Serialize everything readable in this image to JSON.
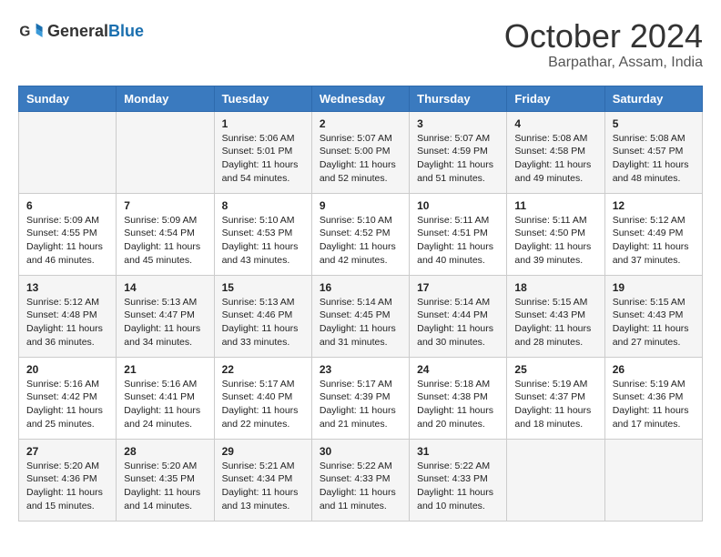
{
  "header": {
    "logo_general": "General",
    "logo_blue": "Blue",
    "month_title": "October 2024",
    "location": "Barpathar, Assam, India"
  },
  "weekdays": [
    "Sunday",
    "Monday",
    "Tuesday",
    "Wednesday",
    "Thursday",
    "Friday",
    "Saturday"
  ],
  "weeks": [
    [
      {
        "day": "",
        "content": ""
      },
      {
        "day": "",
        "content": ""
      },
      {
        "day": "1",
        "content": "Sunrise: 5:06 AM\nSunset: 5:01 PM\nDaylight: 11 hours and 54 minutes."
      },
      {
        "day": "2",
        "content": "Sunrise: 5:07 AM\nSunset: 5:00 PM\nDaylight: 11 hours and 52 minutes."
      },
      {
        "day": "3",
        "content": "Sunrise: 5:07 AM\nSunset: 4:59 PM\nDaylight: 11 hours and 51 minutes."
      },
      {
        "day": "4",
        "content": "Sunrise: 5:08 AM\nSunset: 4:58 PM\nDaylight: 11 hours and 49 minutes."
      },
      {
        "day": "5",
        "content": "Sunrise: 5:08 AM\nSunset: 4:57 PM\nDaylight: 11 hours and 48 minutes."
      }
    ],
    [
      {
        "day": "6",
        "content": "Sunrise: 5:09 AM\nSunset: 4:55 PM\nDaylight: 11 hours and 46 minutes."
      },
      {
        "day": "7",
        "content": "Sunrise: 5:09 AM\nSunset: 4:54 PM\nDaylight: 11 hours and 45 minutes."
      },
      {
        "day": "8",
        "content": "Sunrise: 5:10 AM\nSunset: 4:53 PM\nDaylight: 11 hours and 43 minutes."
      },
      {
        "day": "9",
        "content": "Sunrise: 5:10 AM\nSunset: 4:52 PM\nDaylight: 11 hours and 42 minutes."
      },
      {
        "day": "10",
        "content": "Sunrise: 5:11 AM\nSunset: 4:51 PM\nDaylight: 11 hours and 40 minutes."
      },
      {
        "day": "11",
        "content": "Sunrise: 5:11 AM\nSunset: 4:50 PM\nDaylight: 11 hours and 39 minutes."
      },
      {
        "day": "12",
        "content": "Sunrise: 5:12 AM\nSunset: 4:49 PM\nDaylight: 11 hours and 37 minutes."
      }
    ],
    [
      {
        "day": "13",
        "content": "Sunrise: 5:12 AM\nSunset: 4:48 PM\nDaylight: 11 hours and 36 minutes."
      },
      {
        "day": "14",
        "content": "Sunrise: 5:13 AM\nSunset: 4:47 PM\nDaylight: 11 hours and 34 minutes."
      },
      {
        "day": "15",
        "content": "Sunrise: 5:13 AM\nSunset: 4:46 PM\nDaylight: 11 hours and 33 minutes."
      },
      {
        "day": "16",
        "content": "Sunrise: 5:14 AM\nSunset: 4:45 PM\nDaylight: 11 hours and 31 minutes."
      },
      {
        "day": "17",
        "content": "Sunrise: 5:14 AM\nSunset: 4:44 PM\nDaylight: 11 hours and 30 minutes."
      },
      {
        "day": "18",
        "content": "Sunrise: 5:15 AM\nSunset: 4:43 PM\nDaylight: 11 hours and 28 minutes."
      },
      {
        "day": "19",
        "content": "Sunrise: 5:15 AM\nSunset: 4:43 PM\nDaylight: 11 hours and 27 minutes."
      }
    ],
    [
      {
        "day": "20",
        "content": "Sunrise: 5:16 AM\nSunset: 4:42 PM\nDaylight: 11 hours and 25 minutes."
      },
      {
        "day": "21",
        "content": "Sunrise: 5:16 AM\nSunset: 4:41 PM\nDaylight: 11 hours and 24 minutes."
      },
      {
        "day": "22",
        "content": "Sunrise: 5:17 AM\nSunset: 4:40 PM\nDaylight: 11 hours and 22 minutes."
      },
      {
        "day": "23",
        "content": "Sunrise: 5:17 AM\nSunset: 4:39 PM\nDaylight: 11 hours and 21 minutes."
      },
      {
        "day": "24",
        "content": "Sunrise: 5:18 AM\nSunset: 4:38 PM\nDaylight: 11 hours and 20 minutes."
      },
      {
        "day": "25",
        "content": "Sunrise: 5:19 AM\nSunset: 4:37 PM\nDaylight: 11 hours and 18 minutes."
      },
      {
        "day": "26",
        "content": "Sunrise: 5:19 AM\nSunset: 4:36 PM\nDaylight: 11 hours and 17 minutes."
      }
    ],
    [
      {
        "day": "27",
        "content": "Sunrise: 5:20 AM\nSunset: 4:36 PM\nDaylight: 11 hours and 15 minutes."
      },
      {
        "day": "28",
        "content": "Sunrise: 5:20 AM\nSunset: 4:35 PM\nDaylight: 11 hours and 14 minutes."
      },
      {
        "day": "29",
        "content": "Sunrise: 5:21 AM\nSunset: 4:34 PM\nDaylight: 11 hours and 13 minutes."
      },
      {
        "day": "30",
        "content": "Sunrise: 5:22 AM\nSunset: 4:33 PM\nDaylight: 11 hours and 11 minutes."
      },
      {
        "day": "31",
        "content": "Sunrise: 5:22 AM\nSunset: 4:33 PM\nDaylight: 11 hours and 10 minutes."
      },
      {
        "day": "",
        "content": ""
      },
      {
        "day": "",
        "content": ""
      }
    ]
  ]
}
